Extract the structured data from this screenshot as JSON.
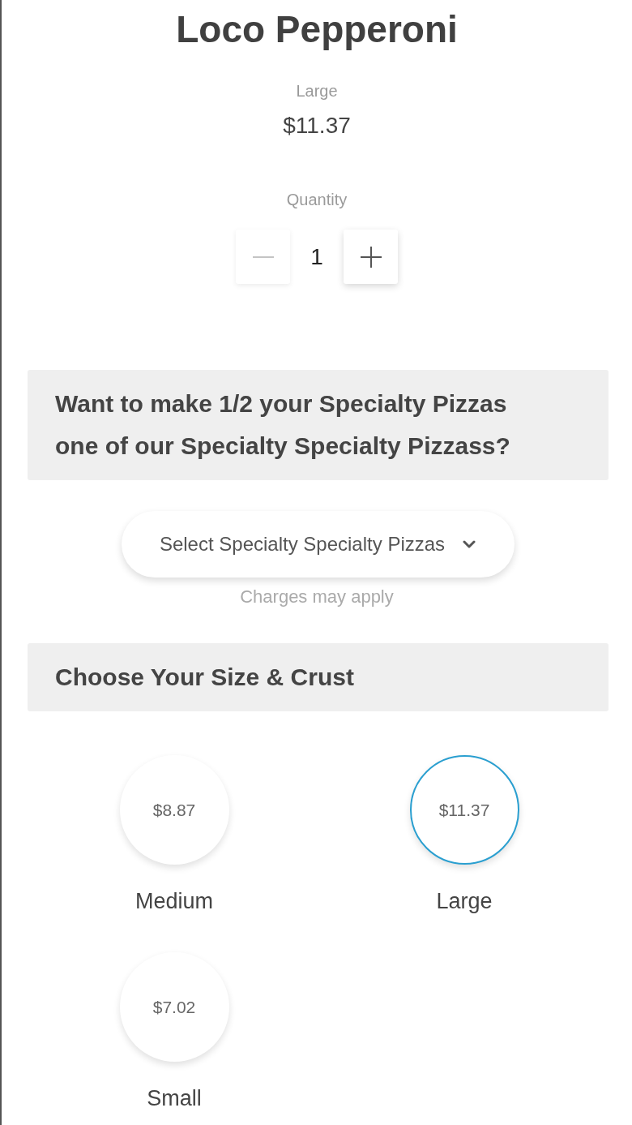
{
  "product": {
    "title": "Loco Pepperoni",
    "size": "Large",
    "price": "$11.37"
  },
  "quantity": {
    "label": "Quantity",
    "value": "1",
    "decrease_disabled": true
  },
  "half_pizza": {
    "heading": "Want to make 1/2 your Specialty Pizzas one of our Specialty Specialty Pizzass?",
    "select": {
      "label": "Select Specialty Specialty Pizzas"
    },
    "note": "Charges may apply"
  },
  "size_crust": {
    "heading": "Choose Your Size & Crust",
    "options": [
      {
        "name": "Medium",
        "price": "$8.87",
        "selected": false
      },
      {
        "name": "Large",
        "price": "$11.37",
        "selected": true
      },
      {
        "name": "Small",
        "price": "$7.02",
        "selected": false
      }
    ]
  }
}
